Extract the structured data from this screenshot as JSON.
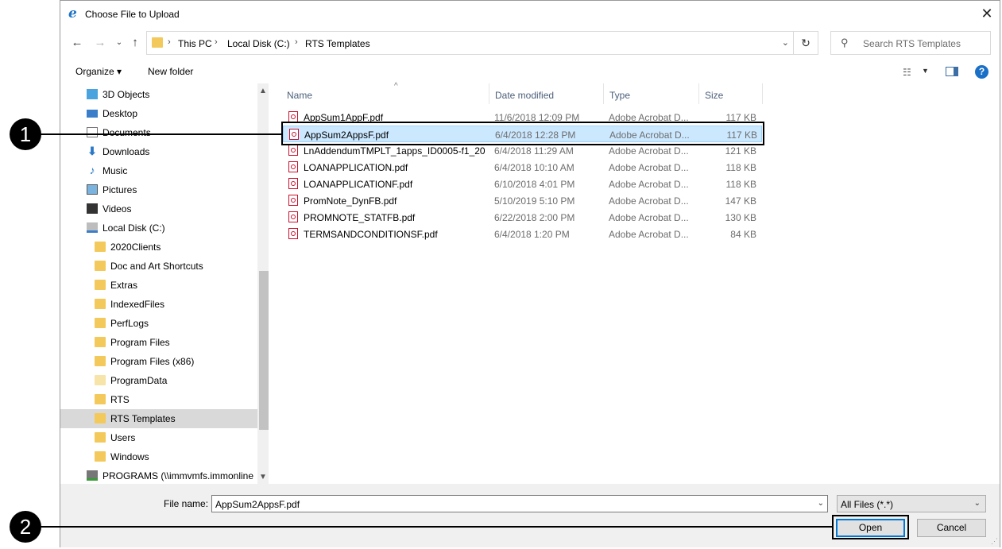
{
  "window": {
    "title": "Choose File to Upload",
    "close": "✕"
  },
  "address": {
    "crumbs": [
      "This PC",
      "Local Disk (C:)",
      "RTS Templates"
    ],
    "search_placeholder": "Search RTS Templates"
  },
  "toolbar": {
    "organize": "Organize ▾",
    "new_folder": "New folder",
    "help": "?"
  },
  "nav_items": [
    {
      "label": "3D Objects",
      "icon": "3d-objects-icon"
    },
    {
      "label": "Desktop",
      "icon": "desktop-icon"
    },
    {
      "label": "Documents",
      "icon": "documents-icon"
    },
    {
      "label": "Downloads",
      "icon": "downloads-icon"
    },
    {
      "label": "Music",
      "icon": "music-icon"
    },
    {
      "label": "Pictures",
      "icon": "pictures-icon"
    },
    {
      "label": "Videos",
      "icon": "videos-icon"
    },
    {
      "label": "Local Disk (C:)",
      "icon": "local-disk-icon"
    },
    {
      "label": "2020Clients",
      "icon": "folder-icon"
    },
    {
      "label": "Doc and Art Shortcuts",
      "icon": "folder-icon"
    },
    {
      "label": "Extras",
      "icon": "folder-icon"
    },
    {
      "label": "IndexedFiles",
      "icon": "folder-icon"
    },
    {
      "label": "PerfLogs",
      "icon": "folder-icon"
    },
    {
      "label": "Program Files",
      "icon": "folder-icon"
    },
    {
      "label": "Program Files (x86)",
      "icon": "folder-icon"
    },
    {
      "label": "ProgramData",
      "icon": "folder-icon"
    },
    {
      "label": "RTS",
      "icon": "folder-icon"
    },
    {
      "label": "RTS Templates",
      "icon": "folder-icon",
      "selected": true
    },
    {
      "label": "Users",
      "icon": "folder-icon"
    },
    {
      "label": "Windows",
      "icon": "folder-icon"
    },
    {
      "label": "PROGRAMS (\\\\immvmfs.immonline",
      "icon": "network-drive-icon"
    }
  ],
  "columns": {
    "name": "Name",
    "date": "Date modified",
    "type": "Type",
    "size": "Size"
  },
  "files": [
    {
      "name": "AppSum1AppF.pdf",
      "date": "11/6/2018 12:09 PM",
      "type": "Adobe Acrobat D...",
      "size": "117 KB"
    },
    {
      "name": "AppSum2AppsF.pdf",
      "date": "6/4/2018 12:28 PM",
      "type": "Adobe Acrobat D...",
      "size": "117 KB",
      "selected": true
    },
    {
      "name": "LnAddendumTMPLT_1apps_ID0005-f1_20...",
      "date": "6/4/2018 11:29 AM",
      "type": "Adobe Acrobat D...",
      "size": "121 KB"
    },
    {
      "name": "LOANAPPLICATION.pdf",
      "date": "6/4/2018 10:10 AM",
      "type": "Adobe Acrobat D...",
      "size": "118 KB"
    },
    {
      "name": "LOANAPPLICATIONF.pdf",
      "date": "6/10/2018 4:01 PM",
      "type": "Adobe Acrobat D...",
      "size": "118 KB"
    },
    {
      "name": "PromNote_DynFB.pdf",
      "date": "5/10/2019 5:10 PM",
      "type": "Adobe Acrobat D...",
      "size": "147 KB"
    },
    {
      "name": "PROMNOTE_STATFB.pdf",
      "date": "6/22/2018 2:00 PM",
      "type": "Adobe Acrobat D...",
      "size": "130 KB"
    },
    {
      "name": "TERMSANDCONDITIONSF.pdf",
      "date": "6/4/2018 1:20 PM",
      "type": "Adobe Acrobat D...",
      "size": "84 KB"
    }
  ],
  "footer": {
    "file_name_label": "File name:",
    "file_name_value": "AppSum2AppsF.pdf",
    "filter": "All Files (*.*)",
    "open": "Open",
    "cancel": "Cancel"
  },
  "callouts": [
    "1",
    "2"
  ]
}
